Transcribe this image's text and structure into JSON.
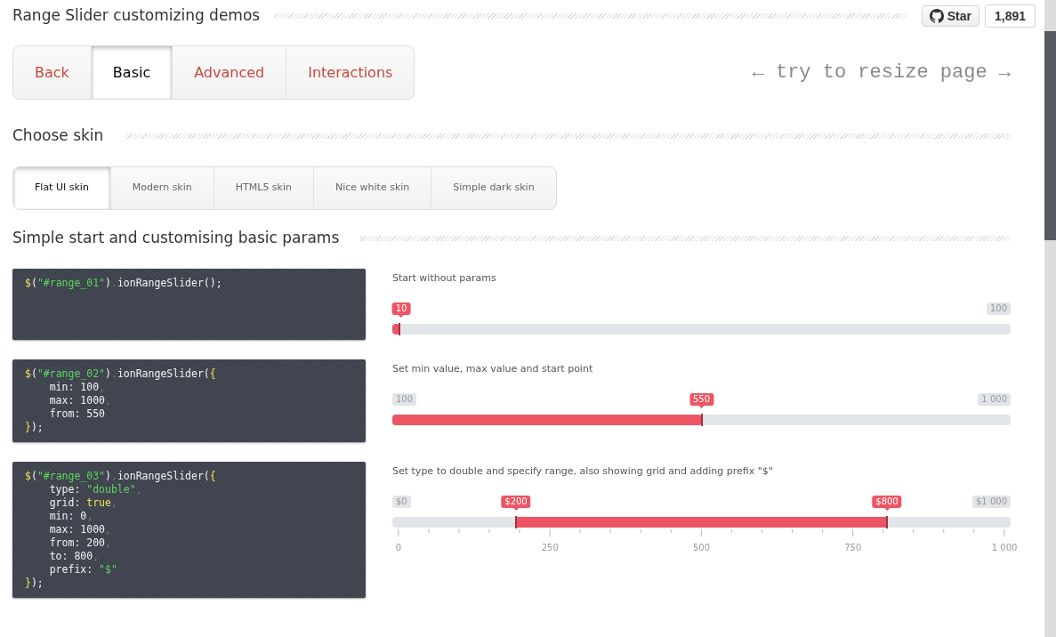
{
  "header": {
    "title": "Range Slider customizing demos",
    "star_button": "Star",
    "star_count": "1,891"
  },
  "nav_tabs": [
    {
      "label": "Back",
      "selected": false
    },
    {
      "label": "Basic",
      "selected": true
    },
    {
      "label": "Advanced",
      "selected": false
    },
    {
      "label": "Interactions",
      "selected": false
    }
  ],
  "resize_hint": "← try to resize page →",
  "skin_section": {
    "title": "Choose skin",
    "tabs": [
      {
        "label": "Flat UI skin",
        "selected": true
      },
      {
        "label": "Modern skin",
        "selected": false
      },
      {
        "label": "HTML5 skin",
        "selected": false
      },
      {
        "label": "Nice white skin",
        "selected": false
      },
      {
        "label": "Simple dark skin",
        "selected": false
      }
    ]
  },
  "demo_section": {
    "title": "Simple start and customising basic params",
    "demos": [
      {
        "code": [
          [
            {
              "text": "$",
              "kind": "sym"
            },
            {
              "text": "(",
              "kind": "plain"
            },
            {
              "text": "\"#range_01\"",
              "kind": "str"
            },
            {
              "text": ")",
              "kind": "plain"
            },
            {
              "text": ".",
              "kind": "punct"
            },
            {
              "text": "ionRangeSlider();",
              "kind": "plain"
            }
          ]
        ],
        "caption": "Start without params",
        "slider": {
          "kind": "single",
          "max_label": "100",
          "handles": [
            {
              "label": "10",
              "level": 0.012
            }
          ]
        }
      },
      {
        "code": [
          [
            {
              "text": "$",
              "kind": "sym"
            },
            {
              "text": "(",
              "kind": "plain"
            },
            {
              "text": "\"#range_02\"",
              "kind": "str"
            },
            {
              "text": ")",
              "kind": "plain"
            },
            {
              "text": ".",
              "kind": "punct"
            },
            {
              "text": "ionRangeSlider(",
              "kind": "plain"
            },
            {
              "text": "{",
              "kind": "sym"
            }
          ],
          [
            {
              "text": "    min: 100",
              "kind": "plain"
            },
            {
              "text": ",",
              "kind": "punct"
            }
          ],
          [
            {
              "text": "    max: 1000",
              "kind": "plain"
            },
            {
              "text": ",",
              "kind": "punct"
            }
          ],
          [
            {
              "text": "    from: 550",
              "kind": "plain"
            }
          ],
          [
            {
              "text": "}",
              "kind": "sym"
            },
            {
              "text": ");",
              "kind": "plain"
            }
          ]
        ],
        "caption": "Set min value, max value and start point",
        "slider": {
          "kind": "single",
          "min_label": "100",
          "max_label": "1 000",
          "handles": [
            {
              "label": "550",
              "level": 0.5
            }
          ]
        }
      },
      {
        "code": [
          [
            {
              "text": "$",
              "kind": "sym"
            },
            {
              "text": "(",
              "kind": "plain"
            },
            {
              "text": "\"#range_03\"",
              "kind": "str"
            },
            {
              "text": ")",
              "kind": "plain"
            },
            {
              "text": ".",
              "kind": "punct"
            },
            {
              "text": "ionRangeSlider(",
              "kind": "plain"
            },
            {
              "text": "{",
              "kind": "sym"
            }
          ],
          [
            {
              "text": "    type: ",
              "kind": "plain"
            },
            {
              "text": "\"double\"",
              "kind": "str"
            },
            {
              "text": ",",
              "kind": "punct"
            }
          ],
          [
            {
              "text": "    grid: ",
              "kind": "plain"
            },
            {
              "text": "true",
              "kind": "sym"
            },
            {
              "text": ",",
              "kind": "punct"
            }
          ],
          [
            {
              "text": "    min: 0",
              "kind": "plain"
            },
            {
              "text": ",",
              "kind": "punct"
            }
          ],
          [
            {
              "text": "    max: 1000",
              "kind": "plain"
            },
            {
              "text": ",",
              "kind": "punct"
            }
          ],
          [
            {
              "text": "    from: 200",
              "kind": "plain"
            },
            {
              "text": ",",
              "kind": "punct"
            }
          ],
          [
            {
              "text": "    to: 800",
              "kind": "plain"
            },
            {
              "text": ",",
              "kind": "punct"
            }
          ],
          [
            {
              "text": "    prefix: ",
              "kind": "plain"
            },
            {
              "text": "\"$\"",
              "kind": "str"
            }
          ],
          [
            {
              "text": "}",
              "kind": "sym"
            },
            {
              "text": ");",
              "kind": "plain"
            }
          ]
        ],
        "caption": "Set type to double and specify range, also showing grid and adding prefix \"$\"",
        "slider": {
          "kind": "double",
          "min_label": "$0",
          "max_label": "$1 000",
          "handles": [
            {
              "label": "$200",
              "level": 0.2
            },
            {
              "label": "$800",
              "level": 0.8
            }
          ],
          "grid": [
            "0",
            "250",
            "500",
            "750",
            "1 000"
          ]
        }
      }
    ]
  }
}
